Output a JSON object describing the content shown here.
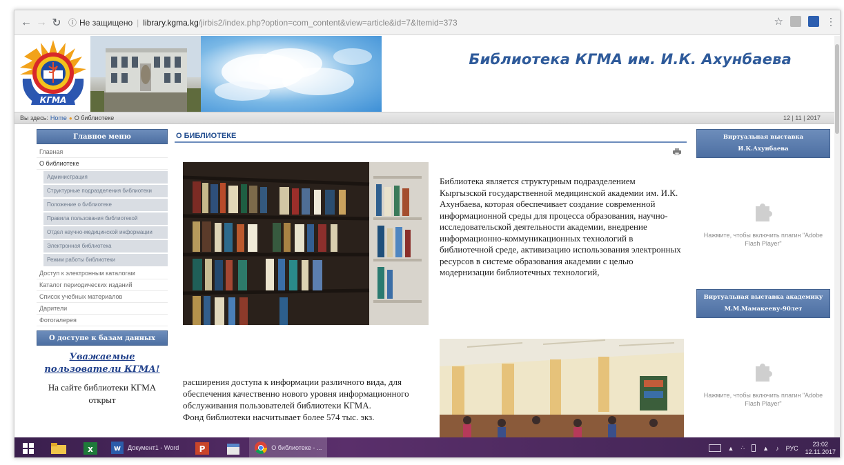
{
  "browser": {
    "security_label": "Не защищено",
    "url_host": "library.kgma.kg",
    "url_path": "/jirbis2/index.php?option=com_content&view=article&id=7&Itemid=373"
  },
  "header": {
    "site_title": "Библиотека КГМА им. И.К. Ахунбаева",
    "logo_text": "КГМА"
  },
  "breadcrumb": {
    "prefix": "Вы здесь:",
    "home": "Home",
    "current": "О библиотеке",
    "date": "12 | 11 | 2017"
  },
  "main_menu": {
    "title": "Главное меню",
    "items": [
      {
        "label": "Главная",
        "level": 1
      },
      {
        "label": "О библиотеке",
        "level": 1
      },
      {
        "label": "Администрация",
        "level": 2
      },
      {
        "label": "Структурные подразделения библиотеки",
        "level": 2
      },
      {
        "label": "Положение о библиотеке",
        "level": 2
      },
      {
        "label": "Правила пользования библиотекой",
        "level": 2
      },
      {
        "label": "Отдел научно-медицинской информации",
        "level": 2
      },
      {
        "label": "Электронная библиотека",
        "level": 2
      },
      {
        "label": "Режим работы библиотеки",
        "level": 2
      },
      {
        "label": "Доступ к электронным каталогам",
        "level": 1
      },
      {
        "label": "Каталог периодических изданий",
        "level": 1
      },
      {
        "label": "Список учебных материалов",
        "level": 1
      },
      {
        "label": "Дарители",
        "level": 1
      },
      {
        "label": "Фотогалерея",
        "level": 1
      }
    ]
  },
  "access_box": {
    "title": "О доступе к базам данных",
    "greeting": "Уважаемые пользователи КГМА!",
    "text": "На сайте библиотеки КГМА открыт"
  },
  "article": {
    "title": "О БИБЛИОТЕКЕ",
    "para1": "Библиотека является структурным подразделением  Кыргызской государственной медицинской академии им. И.К. Ахунбаева, которая обеспечивает создание современной информационной среды для процесса образования, научно-исследовательской деятельности академии, внедрение информационно-коммуникационных технологий в библиотечной среде, активизацию использования электронных ресурсов в системе образования академии с целью модернизации библиотечных технологий,",
    "para2_a": "расширения доступа к информации различного вида, для обеспечения качественно нового уровня информационного обслуживания пользователей библиотеки КГМА.",
    "para2_b": "Фонд библиотеки насчитывает более 574 тыс. экз."
  },
  "right_sidebar": {
    "box1_title": "Виртуальная выставка И.К.Ахунбаева",
    "box2_title": "Виртуальная выставка академику М.М.Мамакееву-90лет",
    "plugin_text": "Нажмите, чтобы включить плагин \"Adobe Flash Player\""
  },
  "taskbar": {
    "word_label": "Документ1 - Word",
    "chrome_label": "О библиотеке - ...",
    "lang": "РУС",
    "time": "23:02",
    "date": "12.11.2017"
  }
}
